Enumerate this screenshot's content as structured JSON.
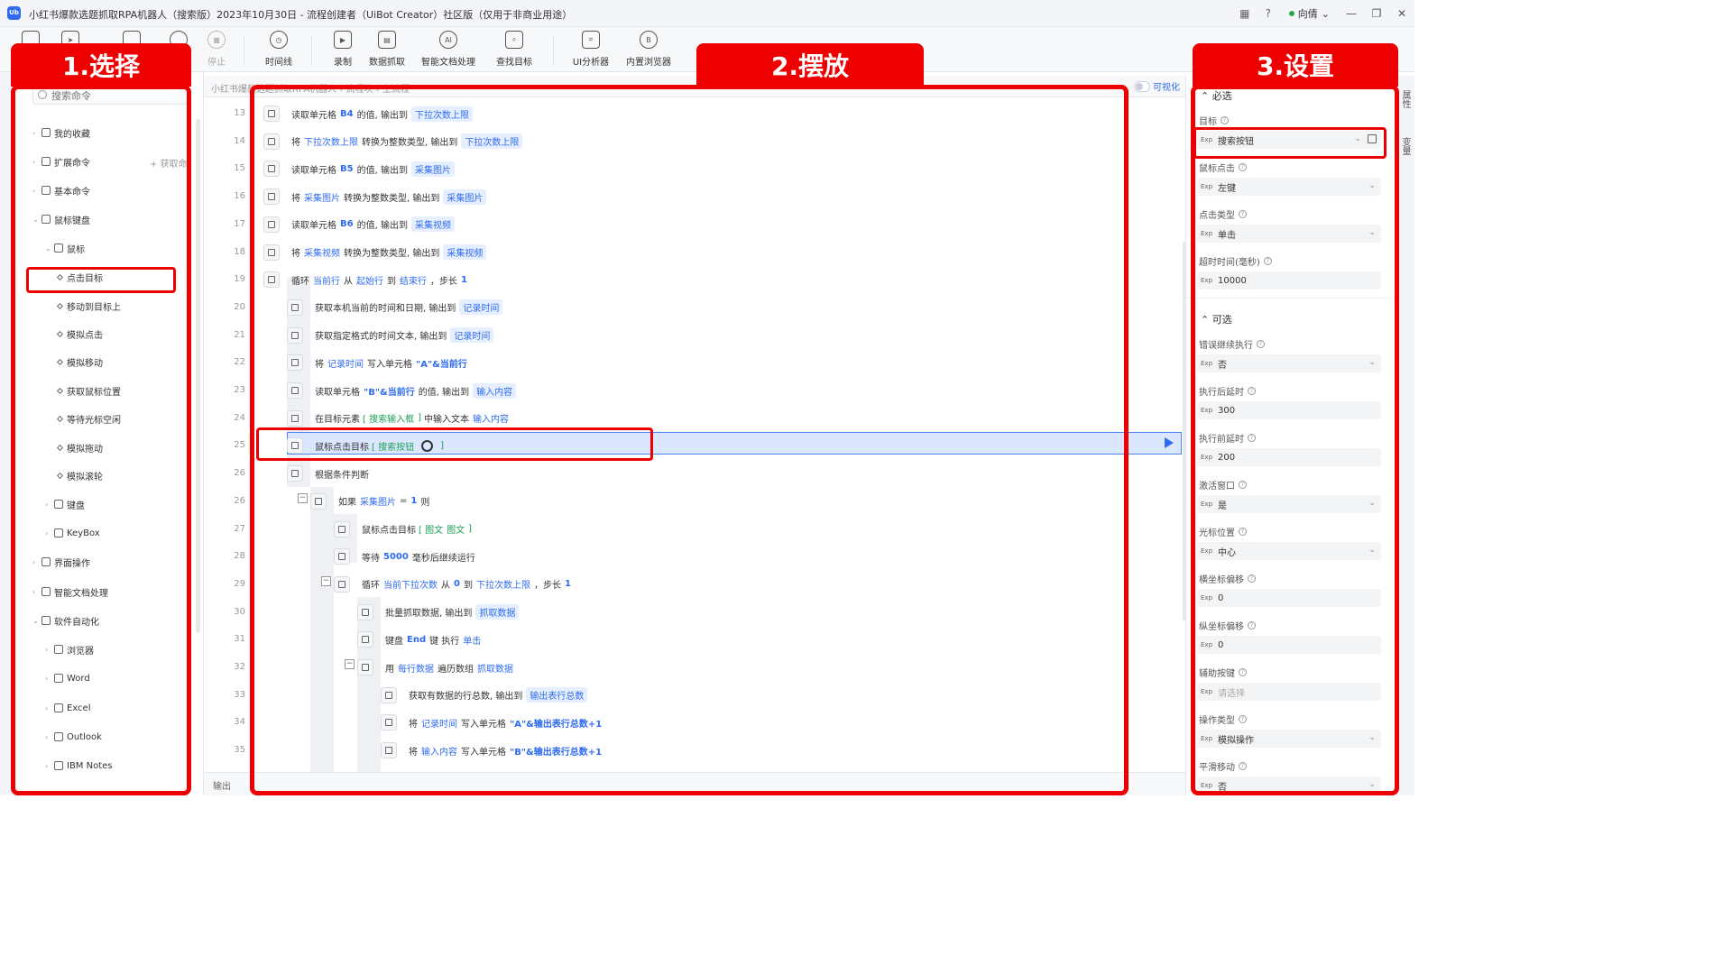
{
  "window": {
    "title": "小红书爆款选题抓取RPA机器人（搜索版）2023年10月30日 - 流程创建者（UiBot Creator）社区版（仅用于非商业用途）",
    "user": "向倩",
    "logo": "Ub"
  },
  "toolbar": {
    "stop": "停止",
    "timeline": "时间线",
    "record": "录制",
    "data_scrape": "数据抓取",
    "smart_doc": "智能文档处理",
    "find_target": "查找目标",
    "ui_analyzer": "UI分析器",
    "browser": "内置浏览器"
  },
  "overlay": {
    "select": "1.选择",
    "place": "2.摆放",
    "settings": "3.设置"
  },
  "left_panel": {
    "search_placeholder": "搜索命令",
    "ext_add": "获取命",
    "items": [
      {
        "label": "我的收藏"
      },
      {
        "label": "扩展命令"
      },
      {
        "label": "基本命令"
      },
      {
        "label": "鼠标键盘"
      },
      {
        "label": "鼠标"
      },
      {
        "label": "点击目标"
      },
      {
        "label": "移动到目标上"
      },
      {
        "label": "模拟点击"
      },
      {
        "label": "模拟移动"
      },
      {
        "label": "获取鼠标位置"
      },
      {
        "label": "等待光标空闲"
      },
      {
        "label": "模拟拖动"
      },
      {
        "label": "模拟滚轮"
      },
      {
        "label": "键盘"
      },
      {
        "label": "KeyBox"
      },
      {
        "label": "界面操作"
      },
      {
        "label": "智能文档处理"
      },
      {
        "label": "软件自动化"
      },
      {
        "label": "浏览器"
      },
      {
        "label": "Word"
      },
      {
        "label": "Excel"
      },
      {
        "label": "Outlook"
      },
      {
        "label": "IBM Notes"
      }
    ]
  },
  "tabbar": {
    "crumb": "小红书爆款选题抓取RPA机器人 › 流程块 › 主流程",
    "visualize": "可视化"
  },
  "editor": {
    "rows": [
      {
        "line": "13",
        "tokens": [
          [
            "t",
            "读取单元格"
          ],
          [
            "n",
            "B4"
          ],
          [
            "t",
            "的值, 输出到"
          ],
          [
            "p",
            "下拉次数上限"
          ]
        ]
      },
      {
        "line": "14",
        "tokens": [
          [
            "t",
            "将"
          ],
          [
            "v",
            "下拉次数上限"
          ],
          [
            "t",
            "转换为整数类型, 输出到"
          ],
          [
            "p",
            "下拉次数上限"
          ]
        ]
      },
      {
        "line": "15",
        "tokens": [
          [
            "t",
            "读取单元格"
          ],
          [
            "n",
            "B5"
          ],
          [
            "t",
            "的值, 输出到"
          ],
          [
            "p",
            "采集图片"
          ]
        ]
      },
      {
        "line": "16",
        "tokens": [
          [
            "t",
            "将"
          ],
          [
            "v",
            "采集图片"
          ],
          [
            "t",
            "转换为整数类型, 输出到"
          ],
          [
            "p",
            "采集图片"
          ]
        ]
      },
      {
        "line": "17",
        "tokens": [
          [
            "t",
            "读取单元格"
          ],
          [
            "n",
            "B6"
          ],
          [
            "t",
            "的值, 输出到"
          ],
          [
            "p",
            "采集视频"
          ]
        ]
      },
      {
        "line": "18",
        "tokens": [
          [
            "t",
            "将"
          ],
          [
            "v",
            "采集视频"
          ],
          [
            "t",
            "转换为整数类型, 输出到"
          ],
          [
            "p",
            "采集视频"
          ]
        ]
      },
      {
        "line": "19",
        "tokens": [
          [
            "t",
            "循环"
          ],
          [
            "v",
            "当前行"
          ],
          [
            "t",
            "从"
          ],
          [
            "v",
            "起始行"
          ],
          [
            "t",
            "到"
          ],
          [
            "v",
            "结束行"
          ],
          [
            "t",
            "，步长"
          ],
          [
            "n",
            "1"
          ]
        ]
      },
      {
        "line": "20",
        "tokens": [
          [
            "t",
            "获取本机当前的时间和日期, 输出到"
          ],
          [
            "p",
            "记录时间"
          ]
        ]
      },
      {
        "line": "21",
        "tokens": [
          [
            "t",
            "获取指定格式的时间文本, 输出到"
          ],
          [
            "p",
            "记录时间"
          ]
        ]
      },
      {
        "line": "22",
        "tokens": [
          [
            "t",
            "将"
          ],
          [
            "v",
            "记录时间"
          ],
          [
            "t",
            "写入单元格"
          ],
          [
            "n",
            "\"A\"&当前行"
          ]
        ]
      },
      {
        "line": "23",
        "tokens": [
          [
            "t",
            "读取单元格"
          ],
          [
            "n",
            "\"B\"&当前行"
          ],
          [
            "t",
            "的值, 输出到"
          ],
          [
            "p",
            "输入内容"
          ]
        ]
      },
      {
        "line": "24",
        "tokens": [
          [
            "t",
            "在目标元素"
          ],
          [
            "g",
            "[ 搜索输入框"
          ],
          [
            "g",
            "]"
          ],
          [
            "t",
            "中输入文本"
          ],
          [
            "v",
            "输入内容"
          ]
        ]
      },
      {
        "line": "25",
        "tokens": [
          [
            "t",
            "鼠标点击目标"
          ],
          [
            "g",
            "[ 搜索按钮"
          ],
          [
            "g",
            "]"
          ]
        ]
      },
      {
        "line": "26",
        "tokens": [
          [
            "t",
            "根据条件判断"
          ]
        ]
      },
      {
        "line": "26",
        "tokens": [
          [
            "t",
            "如果"
          ],
          [
            "v",
            "采集图片"
          ],
          [
            "t",
            "="
          ],
          [
            "n",
            "1"
          ],
          [
            "t",
            "则"
          ]
        ]
      },
      {
        "line": "27",
        "tokens": [
          [
            "t",
            "鼠标点击目标"
          ],
          [
            "g",
            "[ 图文"
          ],
          [
            "g",
            "图文"
          ],
          [
            "g",
            "]"
          ]
        ]
      },
      {
        "line": "28",
        "tokens": [
          [
            "t",
            "等待"
          ],
          [
            "n",
            "5000"
          ],
          [
            "t",
            "毫秒后继续运行"
          ]
        ]
      },
      {
        "line": "29",
        "tokens": [
          [
            "t",
            "循环"
          ],
          [
            "v",
            "当前下拉次数"
          ],
          [
            "t",
            "从"
          ],
          [
            "n",
            "0"
          ],
          [
            "t",
            "到"
          ],
          [
            "v",
            "下拉次数上限"
          ],
          [
            "t",
            "，步长"
          ],
          [
            "n",
            "1"
          ]
        ]
      },
      {
        "line": "30",
        "tokens": [
          [
            "t",
            "批量抓取数据, 输出到"
          ],
          [
            "p",
            "抓取数据"
          ]
        ]
      },
      {
        "line": "31",
        "tokens": [
          [
            "t",
            "键盘"
          ],
          [
            "n",
            "End"
          ],
          [
            "t",
            "键 执行"
          ],
          [
            "v",
            "单击"
          ]
        ]
      },
      {
        "line": "32",
        "tokens": [
          [
            "t",
            "用"
          ],
          [
            "v",
            "每行数据"
          ],
          [
            "t",
            "遍历数组"
          ],
          [
            "v",
            "抓取数据"
          ]
        ]
      },
      {
        "line": "33",
        "tokens": [
          [
            "t",
            "获取有数据的行总数, 输出到"
          ],
          [
            "p",
            "输出表行总数"
          ]
        ]
      },
      {
        "line": "34",
        "tokens": [
          [
            "t",
            "将"
          ],
          [
            "v",
            "记录时间"
          ],
          [
            "t",
            "写入单元格"
          ],
          [
            "n",
            "\"A\"&输出表行总数+1"
          ]
        ]
      },
      {
        "line": "35",
        "tokens": [
          [
            "t",
            "将"
          ],
          [
            "v",
            "输入内容"
          ],
          [
            "t",
            "写入单元格"
          ],
          [
            "n",
            "\"B\"&输出表行总数+1"
          ]
        ]
      }
    ]
  },
  "output": {
    "label": "输出"
  },
  "right_panel": {
    "tab_props": "属性",
    "tab_vars": "变量",
    "required": "必选",
    "optional": "可选",
    "exp": "Exp",
    "fields": [
      {
        "label": "目标",
        "value": "搜索按钮"
      },
      {
        "label": "鼠标点击",
        "value": "左键"
      },
      {
        "label": "点击类型",
        "value": "单击"
      },
      {
        "label": "超时时间(毫秒)",
        "value": "10000"
      },
      {
        "label": "错误继续执行",
        "value": "否"
      },
      {
        "label": "执行后延时",
        "value": "300"
      },
      {
        "label": "执行前延时",
        "value": "200"
      },
      {
        "label": "激活窗口",
        "value": "是"
      },
      {
        "label": "光标位置",
        "value": "中心"
      },
      {
        "label": "横坐标偏移",
        "value": "0"
      },
      {
        "label": "纵坐标偏移",
        "value": "0"
      },
      {
        "label": "辅助按键",
        "value": "请选择"
      },
      {
        "label": "操作类型",
        "value": "模拟操作"
      },
      {
        "label": "平滑移动",
        "value": "否"
      }
    ]
  }
}
